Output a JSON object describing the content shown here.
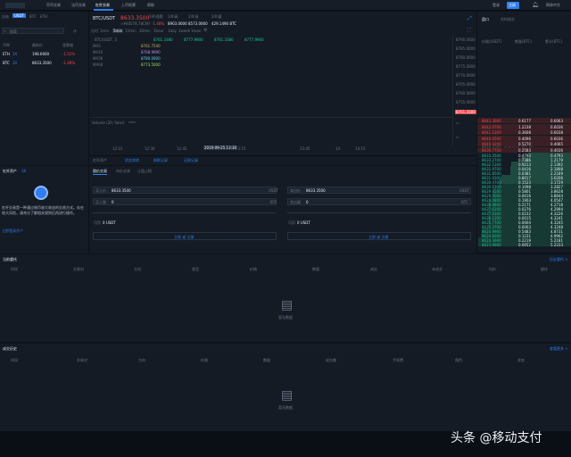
{
  "nav": {
    "items": [
      "币币交易",
      "法币交易",
      "杠杆交易",
      "上币投票",
      "帮助"
    ],
    "active": 2,
    "right": [
      "登录",
      "注册",
      "简体中文"
    ]
  },
  "left_tabs": [
    "自选",
    "USDT",
    "BTC",
    "ETH"
  ],
  "left_search": {
    "placeholder": "搜索"
  },
  "left_header": [
    "币种",
    "最新价",
    "涨跌幅"
  ],
  "pairs": [
    {
      "name": "ETH",
      "tag": "3X",
      "price": "198.6600",
      "change": "-1.51%"
    },
    {
      "name": "BTC",
      "tag": "3X",
      "price": "8633.3500",
      "change": "-1.48%"
    }
  ],
  "ticker": {
    "symbol": "BTC/USDT",
    "price": "8633.3500",
    "cny": "≈¥60578.78CNY",
    "labels": [
      "24h涨跌",
      "24h高",
      "24h低",
      "24h量"
    ],
    "values": [
      "-1.48%",
      "8903.0000",
      "8573.0000",
      "429.1490 BTC"
    ]
  },
  "chart_tabs": [
    "分时",
    "1min",
    "5min",
    "15min",
    "30min",
    "1hour",
    "1day",
    "1week",
    "1mon"
  ],
  "chart_legend": {
    "title": "BTC/USDT, 5",
    "values": [
      "8761.3380",
      "8777.9900",
      "8761.3380",
      "8777.9900"
    ],
    "ma": [
      {
        "name": "MA5",
        "value": "8761.7540"
      },
      {
        "name": "MA10",
        "value": "8768.9990"
      },
      {
        "name": "MA30",
        "value": "8780.0000"
      },
      {
        "name": "MA60",
        "value": "8773.5000"
      }
    ]
  },
  "y_prices": [
    "8790.0000",
    "8785.0000",
    "8780.0000",
    "8775.0000",
    "8770.0000",
    "8765.0000",
    "8760.0000",
    "8755.0000",
    "8750.0000"
  ],
  "current_price_tag": "8761.3380",
  "volume_label": "Volume (20, false)",
  "x_times": [
    "12:15",
    "12:30",
    "12:45",
    "13",
    "13:15",
    "2019-09-25 13:30",
    "13:45",
    "14",
    "14:15"
  ],
  "toolbar_links": [
    "杠杆资产",
    "资金划转",
    "借款记录",
    "还款记录"
  ],
  "orderbook": {
    "tabs": [
      "盘口",
      "实时成交"
    ],
    "header": [
      "价格(USDT)",
      "数量(BTC)",
      "累计(BTC)"
    ],
    "asks": [
      [
        "8643.3600",
        "0.6177",
        "0.6063"
      ],
      [
        "8642.0700",
        "1.2238",
        "0.6036"
      ],
      [
        "8641.5300",
        "0.3608",
        "0.6038"
      ],
      [
        "8640.0500",
        "0.4096",
        "0.6036"
      ],
      [
        "8640.4200",
        "0.5270",
        "0.4065"
      ],
      [
        "8639.7700",
        "0.2583",
        "0.4036"
      ]
    ],
    "mid": {
      "price": "8633.3500",
      "cny": "≈ 60578.78 CNY"
    },
    "bids": [
      [
        "8633.3500",
        "0.4793",
        "0.4793"
      ],
      [
        "8633.2700",
        "0.7386",
        "1.2179"
      ],
      [
        "8632.1200",
        "0.9213",
        "2.1392"
      ],
      [
        "8631.9700",
        "0.0416",
        "2.1808"
      ],
      [
        "8631.8500",
        "0.0381",
        "2.2189"
      ],
      [
        "8631.0300",
        "0.8017",
        "3.0206"
      ],
      [
        "8630.4700",
        "0.1523",
        "3.1729"
      ],
      [
        "8630.0300",
        "0.1098",
        "3.2827"
      ],
      [
        "8629.4100",
        "0.5801",
        "3.8628"
      ],
      [
        "8629.0000",
        "0.0016",
        "3.8644"
      ],
      [
        "8628.4800",
        "0.1903",
        "4.0547"
      ],
      [
        "8628.0800",
        "0.2171",
        "4.2718"
      ],
      [
        "8627.6200",
        "0.0276",
        "4.2994"
      ],
      [
        "8627.0300",
        "0.0232",
        "4.3226"
      ],
      [
        "8626.1200",
        "0.0015",
        "4.3241"
      ],
      [
        "8625.7700",
        "0.0004",
        "4.3245"
      ],
      [
        "8625.3700",
        "0.0003",
        "4.3248"
      ],
      [
        "8624.9900",
        "0.5483",
        "4.8731"
      ],
      [
        "8624.6000",
        "0.1231",
        "4.9962"
      ],
      [
        "8624.3900",
        "0.2219",
        "5.2181"
      ],
      [
        "8623.9900",
        "0.0052",
        "5.2233"
      ]
    ]
  },
  "assets_panel": {
    "title": "杠杆资产",
    "tag": "3X",
    "desc": "杠杆交易是一种通过借币放大收益的交易方式。存在较大风险，请充分了解相关规则后再进行操作。",
    "link": "立即登录开户"
  },
  "order_form": {
    "tabs": [
      "限价交易",
      "市价交易",
      "止盈止损"
    ],
    "buy": {
      "price_label": "买入价",
      "price": "8633.3500",
      "unit": "USDT",
      "amount_label": "买入量",
      "amount": "0",
      "unit2": "BTC",
      "avail_label": "可用",
      "avail": "0 USDT",
      "button": "立即 或 注册"
    },
    "sell": {
      "price_label": "卖出价",
      "price": "8633.3500",
      "unit": "USDT",
      "amount_label": "卖出量",
      "amount": "0",
      "unit2": "BTC",
      "avail_label": "可用",
      "avail": "0 USDT",
      "button": "立即 或 注册"
    }
  },
  "current_orders": {
    "title": "当前委托",
    "link": "历史委托 >",
    "cols": [
      "时间",
      "交易对",
      "方向",
      "类型",
      "价格",
      "数量",
      "成交",
      "未成交",
      "均价",
      "操作"
    ],
    "empty": "暂无数据"
  },
  "history_orders": {
    "title": "成交历史",
    "link": "查看更多 >",
    "cols": [
      "时间",
      "交易对",
      "方向",
      "价格",
      "数量",
      "成交额",
      "手续费",
      "角色",
      "状态"
    ],
    "empty": "暂无数据"
  },
  "watermark": "头条 @移动支付"
}
